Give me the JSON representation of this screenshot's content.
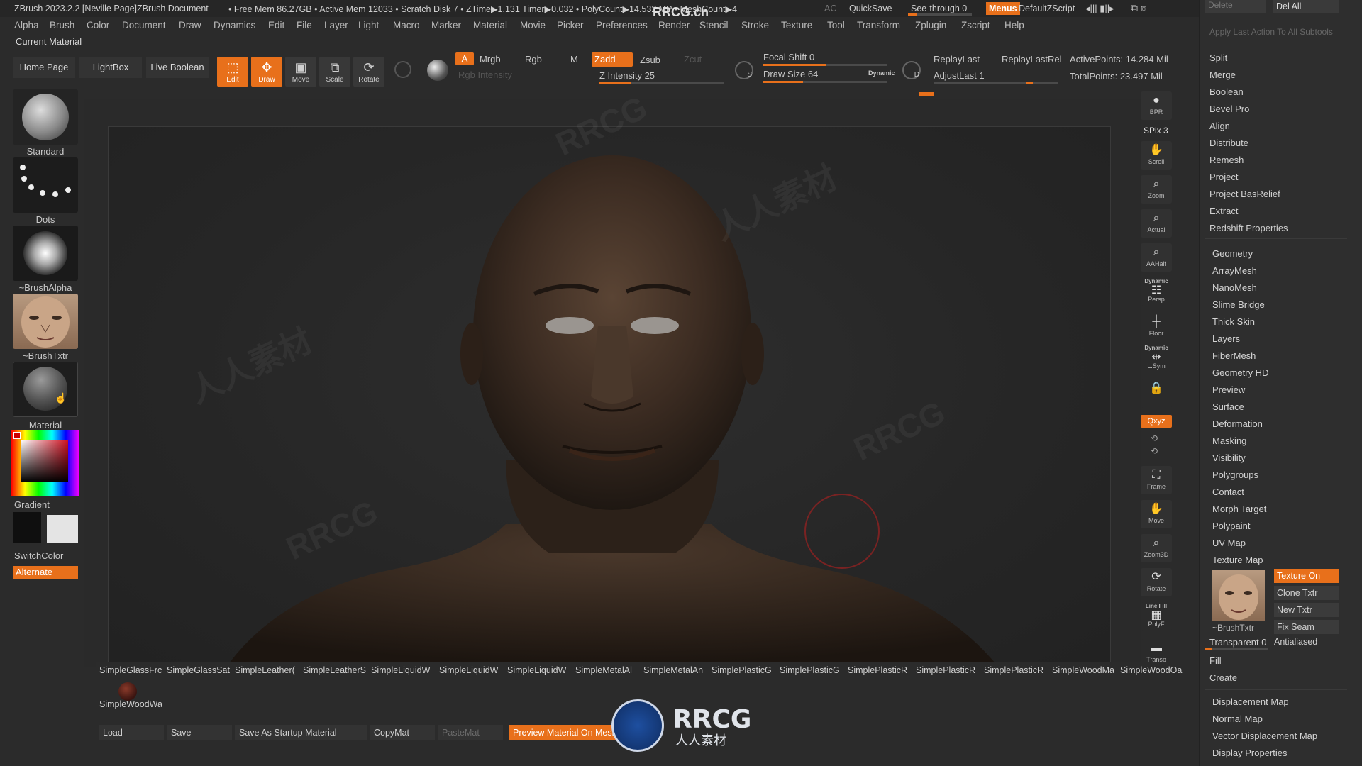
{
  "titlebar": {
    "app_title": "ZBrush 2023.2.2 [Neville Page]ZBrush Document",
    "stats": "• Free Mem 86.27GB • Active Mem 12033 • Scratch Disk 7 •  ZTime▶1.131 Timer▶0.032 • PolyCount▶14.532 MP  • MeshCount▶4",
    "ac": "AC",
    "quicksave": "QuickSave",
    "seethrough": "See-through  0",
    "menus": "Menus",
    "defaultscript": "DefaultZScript"
  },
  "menubar": [
    "Alpha",
    "Brush",
    "Color",
    "Document",
    "Draw",
    "Dynamics",
    "Edit",
    "File",
    "Layer",
    "Light",
    "Macro",
    "Marker",
    "Material",
    "Movie",
    "Picker",
    "Preferences",
    "Render",
    "Stencil",
    "Stroke",
    "Texture",
    "Tool",
    "Transform",
    "Zplugin",
    "Zscript",
    "Help"
  ],
  "current_material": "Current Material",
  "toolbar": {
    "home": "Home Page",
    "lightbox": "LightBox",
    "live_boolean": "Live Boolean",
    "edit": "Edit",
    "draw": "Draw",
    "move": "Move",
    "scale": "Scale",
    "rotate": "Rotate",
    "a": "A",
    "mrgb": "Mrgb",
    "rgb": "Rgb",
    "m": "M",
    "zadd": "Zadd",
    "zsub": "Zsub",
    "zcut": "Zcut",
    "rgb_intensity": "Rgb Intensity",
    "z_intensity": "Z Intensity 25",
    "focal_shift": "Focal Shift 0",
    "draw_size": "Draw Size 64",
    "dynamic": "Dynamic",
    "replay_last": "ReplayLast",
    "replay_last_rel": "ReplayLastRel",
    "adjust_last": "AdjustLast 1",
    "active_points": "ActivePoints: 14.284 Mil",
    "total_points": "TotalPoints: 23.497 Mil",
    "s_label": "S",
    "d_label": "D",
    "z_intensity_level": 0.25,
    "draw_size_level": 0.32,
    "focal_shift_level": 0.5
  },
  "leftpanel": {
    "standard": "Standard",
    "dots": "Dots",
    "brush_alpha": "~BrushAlpha",
    "brush_txtr": "~BrushTxtr",
    "material": "Material",
    "gradient": "Gradient",
    "switch_color": "SwitchColor",
    "alternate": "Alternate"
  },
  "righttools": [
    {
      "label": "BPR",
      "icon": "render-sphere-icon"
    },
    {
      "label": "SPix 3",
      "icon": ""
    },
    {
      "label": "Scroll",
      "icon": "scroll-hand-icon"
    },
    {
      "label": "Zoom",
      "icon": "zoom-magnifier-icon"
    },
    {
      "label": "Actual",
      "icon": "actual-size-icon"
    },
    {
      "label": "AAHalf",
      "icon": "aahalf-icon"
    },
    {
      "label": "Persp",
      "icon": "perspective-grid-icon"
    },
    {
      "label": "Dynamic",
      "icon": ""
    },
    {
      "label": "Floor",
      "icon": "floor-grid-icon"
    },
    {
      "label": "Dynamic",
      "icon": ""
    },
    {
      "label": "L.Sym",
      "icon": "local-symmetry-icon"
    },
    {
      "label": "",
      "icon": "lock-icon"
    },
    {
      "label": "Qxyz",
      "icon": ""
    },
    {
      "label": "Frame",
      "icon": "frame-icon"
    },
    {
      "label": "Move",
      "icon": "move-hand-icon"
    },
    {
      "label": "Zoom3D",
      "icon": "zoom3d-icon"
    },
    {
      "label": "Rotate",
      "icon": "rotate-icon"
    },
    {
      "label": "Line Fill",
      "icon": ""
    },
    {
      "label": "PolyF",
      "icon": "polyframe-icon"
    },
    {
      "label": "Transp",
      "icon": "transparency-icon"
    }
  ],
  "rightpanel": {
    "top_delete": "Delete",
    "del_all": "Del All",
    "apply_last": "Apply Last Action To All Subtools",
    "subtool_actions": [
      "Split",
      "Merge",
      "Boolean",
      "Bevel Pro",
      "Align",
      "Distribute",
      "Remesh",
      "Project",
      "Project BasRelief",
      "Extract",
      "Redshift Properties"
    ],
    "tool_sections": [
      "Geometry",
      "ArrayMesh",
      "NanoMesh",
      "Slime Bridge",
      "Thick Skin",
      "Layers",
      "FiberMesh",
      "Geometry HD",
      "Preview",
      "Surface",
      "Deformation",
      "Masking",
      "Visibility",
      "Polygroups",
      "Contact",
      "Morph Target",
      "Polypaint",
      "UV Map",
      "Texture Map"
    ],
    "texture_on": "Texture On",
    "clone_txtr": "Clone Txtr",
    "new_txtr": "New Txtr",
    "fix_seam": "Fix Seam",
    "brush_txtr": "~BrushTxtr",
    "transparent": "Transparent 0",
    "antialiased": "Antialiased",
    "fill": "Fill",
    "create": "Create",
    "map_sections": [
      "Displacement Map",
      "Normal Map",
      "Vector Displacement Map",
      "Display Properties"
    ]
  },
  "materials": [
    "SimpleGlassFrc",
    "SimpleGlassSat",
    "SimpleLeather(",
    "SimpleLeatherS",
    "SimpleLiquidW",
    "SimpleLiquidW",
    "SimpleLiquidW",
    "SimpleMetalAl",
    "SimpleMetalAn",
    "SimplePlasticG",
    "SimplePlasticG",
    "SimplePlasticR",
    "SimplePlasticR",
    "SimplePlasticR",
    "SimpleWoodMa",
    "SimpleWoodOa"
  ],
  "material_selected": "SimpleWoodWa",
  "matbar": {
    "load": "Load",
    "save": "Save",
    "save_startup": "Save As Startup Material",
    "copymat": "CopyMat",
    "pastemat": "PasteMat",
    "preview": "Preview Material On Mesh"
  },
  "watermark": "RRCG",
  "watermark_cn": "人人素材",
  "logo_text": "RRCG",
  "logo_sub": "人人素材",
  "site": "RRCG.cn"
}
